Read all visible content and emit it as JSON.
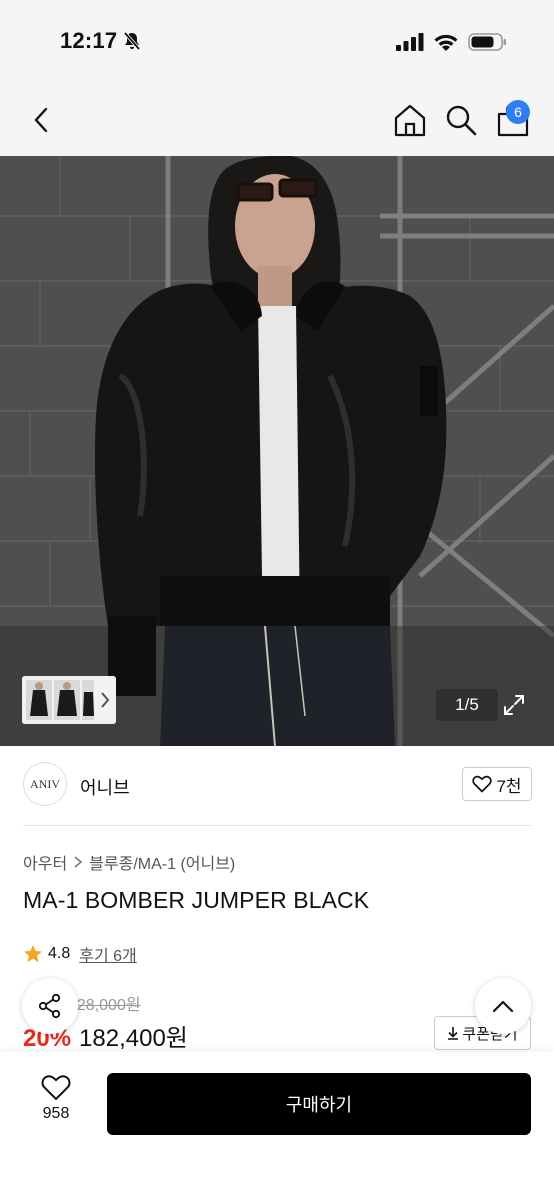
{
  "status_bar": {
    "time": "12:17"
  },
  "nav": {
    "cart_count": "6"
  },
  "gallery": {
    "counter": "1/5"
  },
  "brand": {
    "logo_text": "ANIV",
    "name": "어니브",
    "likes": "7천"
  },
  "breadcrumb": {
    "items": [
      "아우터",
      "블루종/MA-1 (어니브)"
    ]
  },
  "product": {
    "title": "MA-1 BOMBER JUMPER BLACK",
    "rating": "4.8",
    "reviews": "후기 6개",
    "original_price": "228,000원",
    "discount": "20%",
    "sale_price": "182,400원"
  },
  "coupon": {
    "label": "쿠폰받기"
  },
  "bottom": {
    "wish_count": "958",
    "buy_label": "구매하기"
  },
  "colors": {
    "accent_red": "#e9291c",
    "badge_blue": "#2f7df6",
    "star": "#f5a623"
  }
}
